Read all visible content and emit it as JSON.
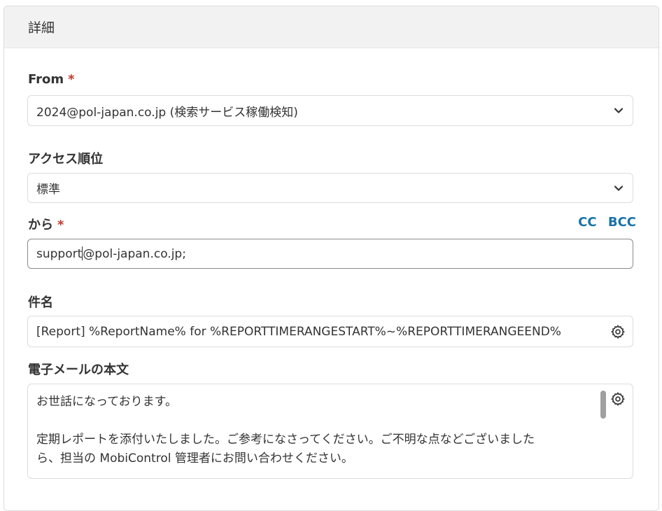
{
  "panel": {
    "title": "詳細"
  },
  "from": {
    "label": "From",
    "required_mark": "*",
    "value": "2024@pol-japan.co.jp (検索サービス稼働検知)"
  },
  "priority": {
    "label": "アクセス順位",
    "value": "標準"
  },
  "to": {
    "label": "から",
    "required_mark": "*",
    "cc_label": "CC",
    "bcc_label": "BCC",
    "value_before_caret": "support",
    "value_after_caret": "@pol-japan.co.jp;"
  },
  "subject": {
    "label": "件名",
    "value": "[Report] %ReportName% for %REPORTTIMERANGESTART%~%REPORTTIMERANGEEND%"
  },
  "body": {
    "label": "電子メールの本文",
    "lines": [
      "お世話になっております。",
      "",
      "定期レポートを添付いたしました。ご参考になさってください。ご不明な点などございました",
      "ら、担当の MobiControl 管理者にお問い合わせください。"
    ]
  },
  "icons": {
    "dropdown": "chevron-down-icon",
    "settings": "gear-icon"
  },
  "colors": {
    "required": "#c0392b",
    "link": "#1a73a8",
    "header_bg": "#f2f2f2"
  }
}
